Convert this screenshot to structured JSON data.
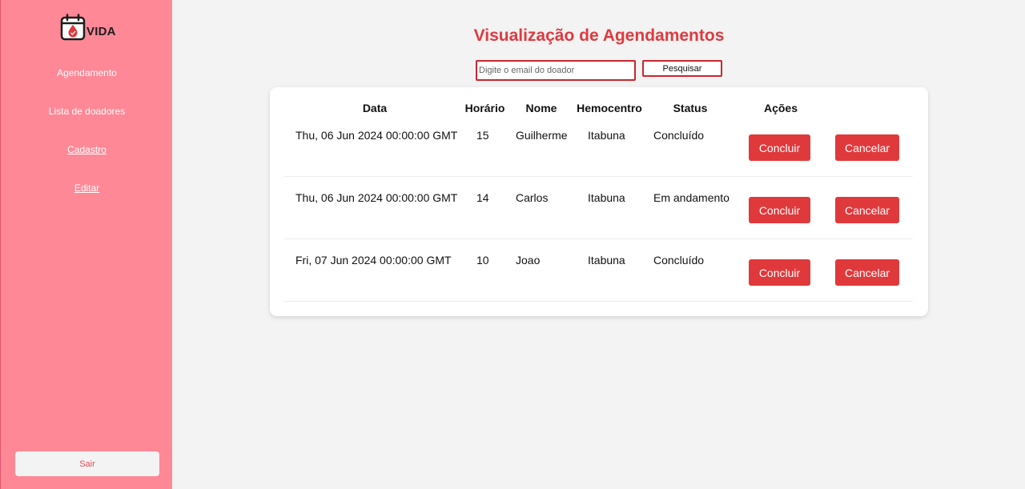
{
  "app": {
    "logo_text": "VIDA",
    "logo_icon": "calendar-blood-drop-icon"
  },
  "sidebar": {
    "items": [
      {
        "label": "Agendamento"
      },
      {
        "label": "Lista de doadores"
      },
      {
        "label": "Cadastro"
      },
      {
        "label": "Editar"
      }
    ],
    "logout_label": "Sair"
  },
  "main": {
    "title": "Visualização de Agendamentos",
    "search": {
      "placeholder": "Digite o email do doador",
      "value": "",
      "button_label": "Pesquisar"
    },
    "table": {
      "headers": [
        "Data",
        "Horário",
        "Nome",
        "Hemocentro",
        "Status",
        "Ações"
      ],
      "rows": [
        {
          "data": "Thu, 06 Jun 2024 00:00:00 GMT",
          "horario": "15",
          "nome": "Guilherme",
          "hemocentro": "Itabuna",
          "status": "Concluído"
        },
        {
          "data": "Thu, 06 Jun 2024 00:00:00 GMT",
          "horario": "14",
          "nome": "Carlos",
          "hemocentro": "Itabuna",
          "status": "Em andamento"
        },
        {
          "data": "Fri, 07 Jun 2024 00:00:00 GMT",
          "horario": "10",
          "nome": "Joao",
          "hemocentro": "Itabuna",
          "status": "Concluído"
        }
      ],
      "action_labels": {
        "conclude": "Concluir",
        "cancel": "Cancelar"
      }
    }
  },
  "colors": {
    "sidebar_bg": "#ff8896",
    "accent_red": "#e0393c",
    "page_bg": "#f3f3f3"
  }
}
